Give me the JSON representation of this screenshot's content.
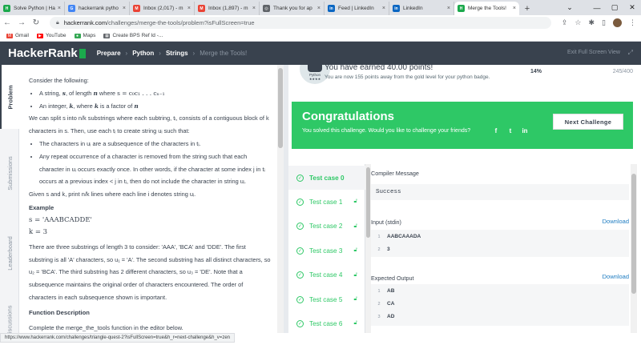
{
  "browser": {
    "tabs": [
      {
        "label": "Solve Python | Ha",
        "color": "#1ba94c",
        "glyph": "H",
        "icon": "hackerrank-icon",
        "active": false
      },
      {
        "label": "hackerrank pytho",
        "color": "#4285f4",
        "glyph": "G",
        "icon": "google-icon",
        "active": false
      },
      {
        "label": "Inbox (2,017) - m",
        "color": "#ea4335",
        "glyph": "M",
        "icon": "gmail-icon",
        "active": false
      },
      {
        "label": "Inbox (1,897) - m",
        "color": "#ea4335",
        "glyph": "M",
        "icon": "gmail-icon",
        "active": false
      },
      {
        "label": "Thank you for ap",
        "color": "#5f6368",
        "glyph": "◎",
        "icon": "globe-icon",
        "active": false
      },
      {
        "label": "Feed | LinkedIn",
        "color": "#0a66c2",
        "glyph": "in",
        "icon": "linkedin-icon",
        "active": false
      },
      {
        "label": "LinkedIn",
        "color": "#0a66c2",
        "glyph": "in",
        "icon": "linkedin-icon",
        "active": false
      },
      {
        "label": "Merge the Tools!",
        "color": "#1ba94c",
        "glyph": "H",
        "icon": "hackerrank-icon",
        "active": true
      }
    ],
    "address_host": "hackerrank.com",
    "address_path": "/challenges/merge-the-tools/problem?isFullScreen=true",
    "bookmarks": [
      {
        "label": "Gmail",
        "color": "#ea4335",
        "glyph": "M",
        "icon": "gmail-icon"
      },
      {
        "label": "YouTube",
        "color": "#ff0000",
        "glyph": "▶",
        "icon": "youtube-icon"
      },
      {
        "label": "Maps",
        "color": "#34a853",
        "glyph": "●",
        "icon": "maps-icon"
      },
      {
        "label": "Create BPS Ref Id -...",
        "color": "#5f6368",
        "glyph": "▦",
        "icon": "page-icon"
      }
    ],
    "status_url": "https://www.hackerrank.com/challenges/triangle-quest-2?isFullScreen=true&h_r=next-challenge&h_v=zen"
  },
  "header": {
    "logo": "HackerRank",
    "crumbs": [
      "Prepare",
      "Python",
      "Strings",
      "Merge the Tools!"
    ],
    "exit_fullscreen": "Exit Full Screen View"
  },
  "sidebar": {
    "tabs": [
      "Problem",
      "Submissions",
      "Leaderboard",
      "Discussions"
    ]
  },
  "problem": {
    "intro": "Consider the following:",
    "b1_pre": "A string, ",
    "b1_s": "s",
    "b1_mid": ", of length ",
    "b1_n": "n",
    "b1_where": " where ",
    "b1_math": "s = c₀c₁ . . . cₙ₋₁",
    "b2_pre": "An integer, ",
    "b2_k": "k",
    "b2_mid": ", where ",
    "b2_k2": "k",
    "b2_post": " is a factor of ",
    "b2_n": "n",
    "p1": "We can split s into n/k substrings where each subtring, tᵢ, consists of a contiguous block of k characters in s. Then, use each tᵢ to create string uᵢ such that:",
    "c1": "The characters in uᵢ are a subsequence of the characters in tᵢ.",
    "c2": "Any repeat occurrence of a character is removed from the string such that each character in uᵢ occurs exactly once. In other words, if the character at some index j in tᵢ occurs at a previous index < j in tᵢ, then do not include the character in string uᵢ.",
    "p2": "Given s and k, print n/k lines where each line i denotes string uᵢ.",
    "example_h": "Example",
    "ex_s": "s = 'AAABCADDE'",
    "ex_k": "k = 3",
    "p3": "There are three substrings of length 3 to consider: 'AAA', 'BCA' and 'DDE'. The first substring is all 'A' characters, so u₁ = 'A'. The second substring has all distinct characters, so u₂ = 'BCA'. The third substring has 2 different characters, so u₃ = 'DE'. Note that a subsequence maintains the original order of characters encountered. The order of characters in each subsequence shown is important.",
    "func_h": "Function Description",
    "p4": "Complete the merge_the_tools function in the editor below."
  },
  "result": {
    "badge_label": "Python",
    "earned": "You have earned 40.00 points!",
    "away": "You are now 155 points away from the gold level for your python badge.",
    "percent": "14%",
    "points": "245/400",
    "congrats_title": "Congratulations",
    "congrats_sub": "You solved this challenge. Would you like to challenge your friends?",
    "next_button": "Next Challenge"
  },
  "testcases": [
    "Test case 0",
    "Test case 1",
    "Test case 2",
    "Test case 3",
    "Test case 4",
    "Test case 5",
    "Test case 6"
  ],
  "output": {
    "compiler_label": "Compiler Message",
    "compiler_value": "Success",
    "input_label": "Input (stdin)",
    "download": "Download",
    "input_lines": [
      {
        "n": "1",
        "v": "AABCAAADA"
      },
      {
        "n": "2",
        "v": "3"
      }
    ],
    "expected_label": "Expected Output",
    "expected_lines": [
      {
        "n": "1",
        "v": "AB"
      },
      {
        "n": "2",
        "v": "CA"
      },
      {
        "n": "3",
        "v": "AD"
      }
    ]
  }
}
